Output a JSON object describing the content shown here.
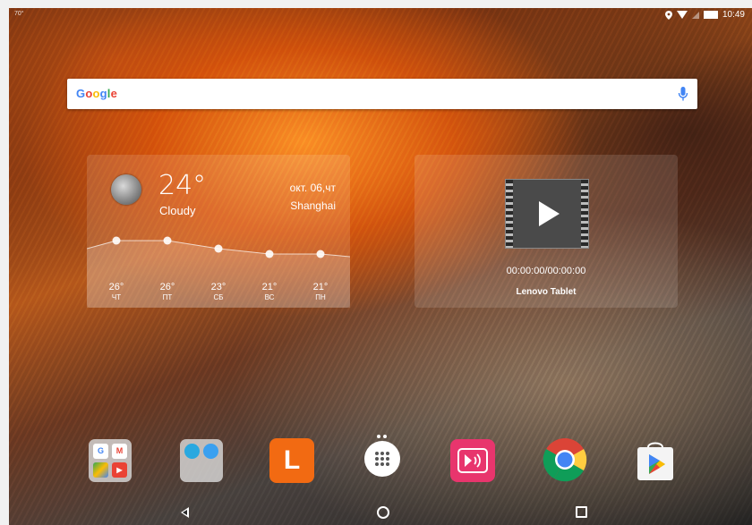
{
  "status_bar": {
    "left_text": "70°",
    "time": "10:49",
    "icons": [
      "location-icon",
      "wifi-icon",
      "signal-icon",
      "battery-icon"
    ]
  },
  "search": {
    "logo": "Google",
    "mic_icon": "mic-icon"
  },
  "weather": {
    "temperature": "24°",
    "condition": "Cloudy",
    "date": "окт. 06,чт",
    "city": "Shanghai",
    "icon": "moon-icon",
    "forecast": [
      {
        "temp": "26°",
        "day": "ЧТ"
      },
      {
        "temp": "26°",
        "day": "ПТ"
      },
      {
        "temp": "23°",
        "day": "СБ"
      },
      {
        "temp": "21°",
        "day": "ВС"
      },
      {
        "temp": "21°",
        "day": "ПН"
      }
    ]
  },
  "video_widget": {
    "time": "00:00:00/00:00:00",
    "title": "Lenovo Tablet",
    "icon": "play-icon"
  },
  "dock": {
    "apps": [
      {
        "name": "google-apps-folder",
        "icon": "folder-icon"
      },
      {
        "name": "tools-folder",
        "icon": "folder-icon"
      },
      {
        "name": "l-app",
        "icon": "l-letter-icon",
        "letter": "L"
      },
      {
        "name": "app-drawer",
        "icon": "apps-grid-icon"
      },
      {
        "name": "media-app",
        "icon": "media-play-icon"
      },
      {
        "name": "chrome",
        "icon": "chrome-icon"
      },
      {
        "name": "play-store",
        "icon": "play-store-icon"
      }
    ],
    "folder1_minis": [
      "G",
      "M",
      "",
      "▶"
    ]
  },
  "nav": {
    "buttons": [
      "back-icon",
      "home-icon",
      "recents-icon"
    ]
  },
  "colors": {
    "accent_orange": "#f26a12",
    "media_pink": "#e8356d",
    "google_blue": "#4285f4"
  }
}
